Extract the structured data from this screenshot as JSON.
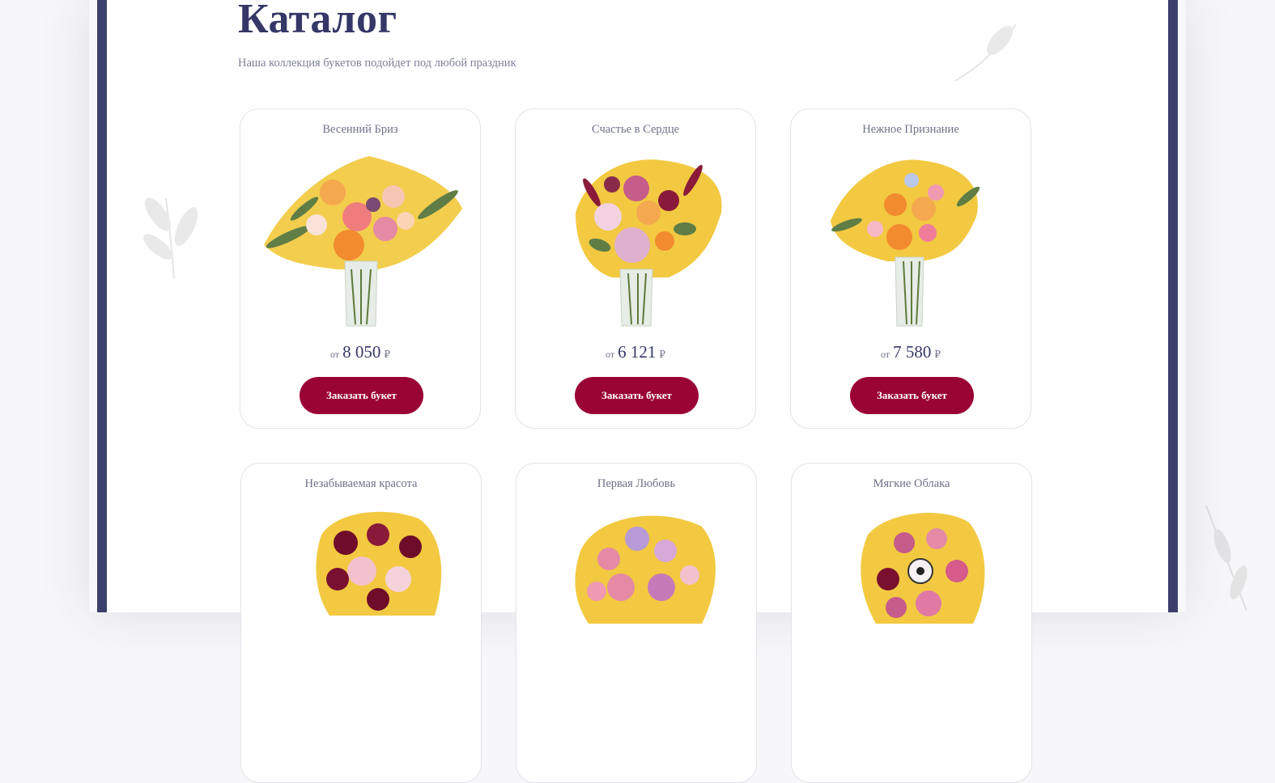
{
  "catalog": {
    "title": "Каталог",
    "subtitle": "Наша коллекция букетов подойдет под любой праздник"
  },
  "products": [
    {
      "name": "Весенний Бриз",
      "price_prefix": "от",
      "price": "8 050",
      "currency": "₽",
      "button": "Заказать букет"
    },
    {
      "name": "Счастье в Сердце",
      "price_prefix": "от",
      "price": "6 121",
      "currency": "₽",
      "button": "Заказать букет"
    },
    {
      "name": "Нежное Признание",
      "price_prefix": "от",
      "price": "7 580",
      "currency": "₽",
      "button": "Заказать букет"
    },
    {
      "name": "Незабываемая красота"
    },
    {
      "name": "Первая Любовь"
    },
    {
      "name": "Мягкие Облака"
    }
  ],
  "colors": {
    "frame": "#3c3f6b",
    "title": "#353866",
    "button": "#9a0434",
    "accent_yellow": "#f0c020"
  }
}
